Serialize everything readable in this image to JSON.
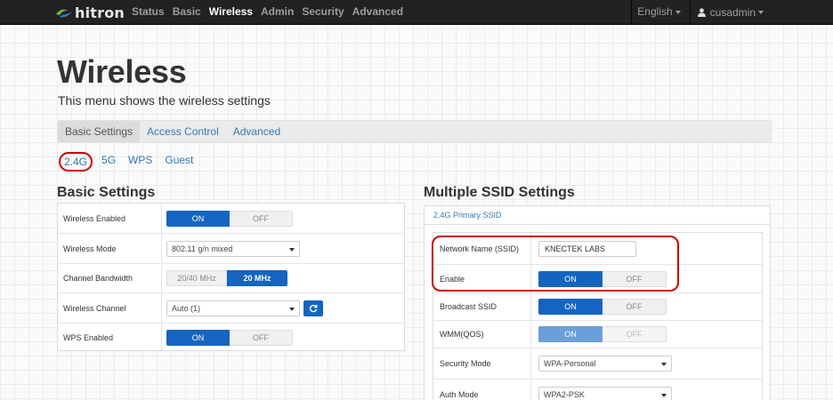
{
  "navbar": {
    "brand": "hitron",
    "links": [
      "Status",
      "Basic",
      "Wireless",
      "Admin",
      "Security",
      "Advanced"
    ],
    "active_link": "Wireless",
    "language": "English",
    "username": "cusadmin"
  },
  "page": {
    "title": "Wireless",
    "subtitle": "This menu shows the wireless settings"
  },
  "tabs": [
    "Basic Settings",
    "Access Control",
    "Advanced"
  ],
  "subtabs": [
    "2.4G",
    "5G",
    "WPS",
    "Guest"
  ],
  "basic_settings": {
    "title": "Basic Settings",
    "wireless_enabled": {
      "label": "Wireless Enabled",
      "on": "ON",
      "off": "OFF"
    },
    "wireless_mode": {
      "label": "Wireless Mode",
      "value": "802.11 g/n mixed"
    },
    "channel_bandwidth": {
      "label": "Channel Bandwidth",
      "opt1": "20/40 MHz",
      "opt2": "20 MHz"
    },
    "wireless_channel": {
      "label": "Wireless Channel",
      "value": "Auto (1)"
    },
    "wps_enabled": {
      "label": "WPS Enabled",
      "on": "ON",
      "off": "OFF"
    }
  },
  "ssid_settings": {
    "title": "Multiple SSID Settings",
    "header": "2.4G Primary SSID",
    "network_name": {
      "label": "Network Name (SSID)",
      "value": "KNECTEK LABS"
    },
    "enable": {
      "label": "Enable",
      "on": "ON",
      "off": "OFF"
    },
    "broadcast": {
      "label": "Broadcast SSID",
      "on": "ON",
      "off": "OFF"
    },
    "wmm": {
      "label": "WMM(QOS)",
      "on": "ON",
      "off": "OFF"
    },
    "security_mode": {
      "label": "Security Mode",
      "value": "WPA-Personal"
    },
    "auth_mode": {
      "label": "Auth Mode",
      "value": "WPA2-PSK"
    }
  },
  "colors": {
    "navbar": "#222222",
    "primary": "#1565c0",
    "link": "#337ab7",
    "highlight": "#cc0000"
  }
}
